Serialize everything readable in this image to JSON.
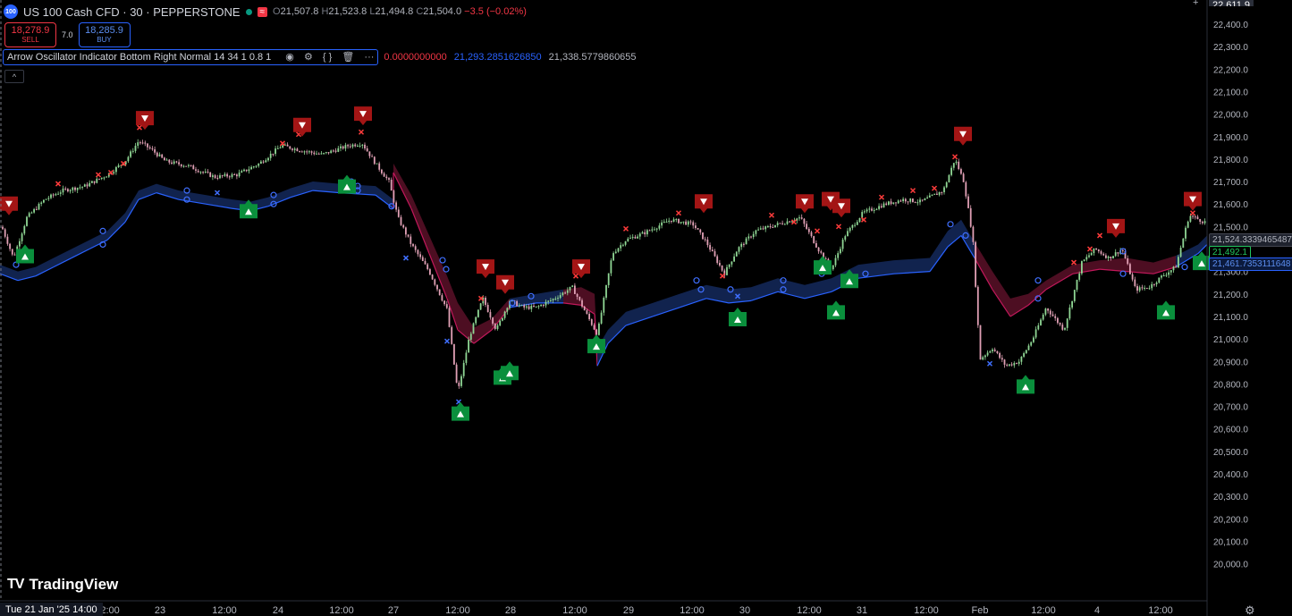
{
  "header": {
    "symbol_badge": "100",
    "symbol_title": "US 100 Cash CFD · 30 · PEPPERSTONE",
    "ohlc": {
      "o_label": "O",
      "o": "21,507.8",
      "h_label": "H",
      "h": "21,523.8",
      "l_label": "L",
      "l": "21,494.8",
      "c_label": "C",
      "c": "21,504.0",
      "change": "−3.5 (−0.02%)"
    }
  },
  "trade": {
    "sell_price": "18,278.9",
    "sell_label": "SELL",
    "spread": "7.0",
    "buy_price": "18,285.9",
    "buy_label": "BUY"
  },
  "indicator": {
    "name": "Arrow Oscillator Indicator Bottom Right Normal 14 34 1 0.8 1",
    "val1": "0.0000000000",
    "val2": "21,293.2851626850",
    "val3": "21,338.5779860655",
    "colors": {
      "val1": "#f23645",
      "val2": "#2962ff",
      "val3": "#b2b5be"
    }
  },
  "branding": {
    "logo_text": "TradingView"
  },
  "price_axis_extra": {
    "top_cut_label": "22,611.9",
    "pill_gray": "21,524.3339465487",
    "pill_green": "21,492.1",
    "pill_blue": "21,461.7353111648"
  },
  "time_axis_cursor": "Tue 21 Jan '25   14:00",
  "colors": {
    "background": "#000000",
    "bull": "#8fd694",
    "bear": "#e0a0b5",
    "buy_signal": "#0a8f3c",
    "sell_signal": "#a31515",
    "band_blue": "#14295c",
    "band_red": "#5a1028",
    "line_blue": "#2962ff",
    "line_red": "#c2185b"
  },
  "chart_data": {
    "type": "candlestick",
    "y_ticks": [
      "22,400.0",
      "22,300.0",
      "22,200.0",
      "22,100.0",
      "22,000.0",
      "21,900.0",
      "21,800.0",
      "21,700.0",
      "21,600.0",
      "21,500.0",
      "21,400.0",
      "21,300.0",
      "21,200.0",
      "21,100.0",
      "21,000.0",
      "20,900.0",
      "20,800.0",
      "20,700.0",
      "20,600.0",
      "20,500.0",
      "20,400.0",
      "20,300.0",
      "20,200.0",
      "20,100.0",
      "20,000.0"
    ],
    "x_ticks": [
      "12:00",
      "23",
      "12:00",
      "24",
      "12:00",
      "27",
      "12:00",
      "28",
      "12:00",
      "29",
      "12:00",
      "30",
      "12:00",
      "31",
      "12:00",
      "Feb",
      "12:00",
      "4",
      "12:00"
    ],
    "ylim": [
      19980,
      22510
    ],
    "price_path": [
      [
        0,
        21520
      ],
      [
        15,
        21360
      ],
      [
        30,
        21540
      ],
      [
        50,
        21620
      ],
      [
        70,
        21660
      ],
      [
        95,
        21680
      ],
      [
        120,
        21730
      ],
      [
        140,
        21790
      ],
      [
        155,
        21880
      ],
      [
        170,
        21840
      ],
      [
        185,
        21790
      ],
      [
        210,
        21770
      ],
      [
        240,
        21720
      ],
      [
        265,
        21730
      ],
      [
        290,
        21780
      ],
      [
        315,
        21860
      ],
      [
        335,
        21840
      ],
      [
        360,
        21820
      ],
      [
        390,
        21860
      ],
      [
        405,
        21870
      ],
      [
        420,
        21780
      ],
      [
        435,
        21700
      ],
      [
        445,
        21540
      ],
      [
        460,
        21420
      ],
      [
        480,
        21300
      ],
      [
        500,
        21130
      ],
      [
        512,
        20760
      ],
      [
        525,
        21010
      ],
      [
        540,
        21180
      ],
      [
        555,
        21040
      ],
      [
        570,
        21170
      ],
      [
        585,
        21140
      ],
      [
        600,
        21140
      ],
      [
        620,
        21180
      ],
      [
        640,
        21230
      ],
      [
        660,
        21080
      ],
      [
        668,
        21020
      ],
      [
        685,
        21380
      ],
      [
        700,
        21440
      ],
      [
        720,
        21470
      ],
      [
        750,
        21530
      ],
      [
        775,
        21510
      ],
      [
        790,
        21430
      ],
      [
        810,
        21290
      ],
      [
        825,
        21400
      ],
      [
        845,
        21480
      ],
      [
        870,
        21510
      ],
      [
        895,
        21540
      ],
      [
        915,
        21400
      ],
      [
        930,
        21310
      ],
      [
        945,
        21460
      ],
      [
        965,
        21560
      ],
      [
        990,
        21600
      ],
      [
        1010,
        21620
      ],
      [
        1030,
        21610
      ],
      [
        1055,
        21660
      ],
      [
        1068,
        21800
      ],
      [
        1078,
        21700
      ],
      [
        1088,
        21450
      ],
      [
        1096,
        20910
      ],
      [
        1110,
        20960
      ],
      [
        1125,
        20880
      ],
      [
        1140,
        20900
      ],
      [
        1155,
        21000
      ],
      [
        1170,
        21140
      ],
      [
        1190,
        21040
      ],
      [
        1210,
        21340
      ],
      [
        1225,
        21400
      ],
      [
        1240,
        21360
      ],
      [
        1255,
        21400
      ],
      [
        1270,
        21220
      ],
      [
        1285,
        21230
      ],
      [
        1300,
        21280
      ],
      [
        1315,
        21320
      ],
      [
        1330,
        21550
      ],
      [
        1347,
        21520
      ]
    ],
    "band": [
      [
        0,
        21330,
        21290,
        "b"
      ],
      [
        20,
        21300,
        21260,
        "b"
      ],
      [
        40,
        21320,
        21280,
        "b"
      ],
      [
        60,
        21360,
        21320,
        "b"
      ],
      [
        80,
        21400,
        21360,
        "b"
      ],
      [
        100,
        21440,
        21400,
        "b"
      ],
      [
        120,
        21480,
        21440,
        "b"
      ],
      [
        140,
        21560,
        21520,
        "b"
      ],
      [
        155,
        21660,
        21620,
        "b"
      ],
      [
        175,
        21690,
        21650,
        "b"
      ],
      [
        200,
        21660,
        21620,
        "b"
      ],
      [
        230,
        21640,
        21600,
        "b"
      ],
      [
        260,
        21620,
        21580,
        "b"
      ],
      [
        280,
        21610,
        21570,
        "b"
      ],
      [
        300,
        21630,
        21590,
        "b"
      ],
      [
        325,
        21670,
        21630,
        "b"
      ],
      [
        350,
        21700,
        21660,
        "b"
      ],
      [
        380,
        21690,
        21650,
        "b"
      ],
      [
        420,
        21680,
        21640,
        "b"
      ],
      [
        440,
        21620,
        21580,
        "r"
      ],
      [
        440,
        21780,
        21740,
        "r"
      ],
      [
        460,
        21640,
        21580,
        "r"
      ],
      [
        480,
        21460,
        21380,
        "r"
      ],
      [
        500,
        21280,
        21180,
        "r"
      ],
      [
        512,
        21160,
        21040,
        "r"
      ],
      [
        530,
        21050,
        20980,
        "r"
      ],
      [
        550,
        21090,
        21040,
        "r"
      ],
      [
        570,
        21180,
        21140,
        "b"
      ],
      [
        600,
        21200,
        21160,
        "b"
      ],
      [
        630,
        21220,
        21160,
        "r"
      ],
      [
        650,
        21230,
        21150,
        "r"
      ],
      [
        665,
        21200,
        21110,
        "r"
      ],
      [
        668,
        20960,
        20880,
        "b"
      ],
      [
        680,
        21040,
        20980,
        "b"
      ],
      [
        700,
        21120,
        21060,
        "b"
      ],
      [
        730,
        21160,
        21100,
        "b"
      ],
      [
        760,
        21200,
        21140,
        "b"
      ],
      [
        790,
        21240,
        21180,
        "b"
      ],
      [
        815,
        21220,
        21160,
        "b"
      ],
      [
        840,
        21230,
        21170,
        "b"
      ],
      [
        870,
        21270,
        21210,
        "b"
      ],
      [
        900,
        21240,
        21180,
        "b"
      ],
      [
        930,
        21270,
        21210,
        "b"
      ],
      [
        960,
        21330,
        21270,
        "b"
      ],
      [
        1000,
        21350,
        21290,
        "b"
      ],
      [
        1040,
        21360,
        21300,
        "b"
      ],
      [
        1060,
        21480,
        21410,
        "b"
      ],
      [
        1075,
        21530,
        21460,
        "b"
      ],
      [
        1090,
        21430,
        21360,
        "r"
      ],
      [
        1110,
        21300,
        21220,
        "r"
      ],
      [
        1130,
        21180,
        21100,
        "r"
      ],
      [
        1150,
        21200,
        21150,
        "r"
      ],
      [
        1170,
        21260,
        21220,
        "r"
      ],
      [
        1200,
        21330,
        21290,
        "r"
      ],
      [
        1230,
        21350,
        21310,
        "r"
      ],
      [
        1260,
        21360,
        21300,
        "r"
      ],
      [
        1290,
        21340,
        21290,
        "r"
      ],
      [
        1315,
        21370,
        21320,
        "b"
      ],
      [
        1340,
        21420,
        21380,
        "b"
      ],
      [
        1350,
        21460,
        21420,
        "b"
      ]
    ],
    "sell_signals": [
      [
        10,
        21590
      ],
      [
        162,
        21970
      ],
      [
        338,
        21940
      ],
      [
        406,
        21990
      ],
      [
        543,
        21310
      ],
      [
        565,
        21240
      ],
      [
        650,
        21310
      ],
      [
        787,
        21600
      ],
      [
        900,
        21600
      ],
      [
        929,
        21610
      ],
      [
        941,
        21580
      ],
      [
        1077,
        21900
      ],
      [
        1248,
        21490
      ],
      [
        1334,
        21610
      ]
    ],
    "buy_signals": [
      [
        28,
        21380
      ],
      [
        278,
        21580
      ],
      [
        388,
        21690
      ],
      [
        515,
        20680
      ],
      [
        562,
        20840
      ],
      [
        570,
        20860
      ],
      [
        667,
        20980
      ],
      [
        825,
        21100
      ],
      [
        920,
        21330
      ],
      [
        935,
        21130
      ],
      [
        950,
        21270
      ],
      [
        1147,
        20800
      ],
      [
        1304,
        21130
      ],
      [
        1344,
        21350
      ]
    ],
    "cross_marks": [
      [
        65,
        21690,
        "r"
      ],
      [
        110,
        21730,
        "r"
      ],
      [
        124,
        21740,
        "r"
      ],
      [
        138,
        21780,
        "r"
      ],
      [
        156,
        21940,
        "r"
      ],
      [
        243,
        21650,
        "b"
      ],
      [
        316,
        21870,
        "r"
      ],
      [
        334,
        21910,
        "r"
      ],
      [
        404,
        21920,
        "r"
      ],
      [
        454,
        21360,
        "b"
      ],
      [
        500,
        20990,
        "b"
      ],
      [
        513,
        20720,
        "b"
      ],
      [
        538,
        21180,
        "r"
      ],
      [
        644,
        21280,
        "r"
      ],
      [
        700,
        21490,
        "r"
      ],
      [
        759,
        21560,
        "r"
      ],
      [
        808,
        21280,
        "r"
      ],
      [
        825,
        21190,
        "b"
      ],
      [
        863,
        21550,
        "r"
      ],
      [
        888,
        21520,
        "r"
      ],
      [
        914,
        21480,
        "r"
      ],
      [
        938,
        21500,
        "r"
      ],
      [
        966,
        21530,
        "r"
      ],
      [
        986,
        21630,
        "r"
      ],
      [
        1021,
        21660,
        "r"
      ],
      [
        1045,
        21670,
        "r"
      ],
      [
        1068,
        21810,
        "r"
      ],
      [
        1107,
        20890,
        "b"
      ],
      [
        1201,
        21340,
        "r"
      ],
      [
        1219,
        21400,
        "r"
      ],
      [
        1230,
        21460,
        "r"
      ],
      [
        1334,
        21560,
        "r"
      ]
    ],
    "circle_marks": [
      [
        18,
        21330
      ],
      [
        115,
        21480
      ],
      [
        115,
        21420
      ],
      [
        209,
        21660
      ],
      [
        209,
        21620
      ],
      [
        306,
        21600
      ],
      [
        306,
        21640
      ],
      [
        393,
        21700
      ],
      [
        400,
        21680
      ],
      [
        400,
        21660
      ],
      [
        438,
        21590
      ],
      [
        495,
        21350
      ],
      [
        499,
        21310
      ],
      [
        573,
        21160
      ],
      [
        594,
        21190
      ],
      [
        779,
        21260
      ],
      [
        784,
        21220
      ],
      [
        817,
        21220
      ],
      [
        876,
        21220
      ],
      [
        876,
        21260
      ],
      [
        919,
        21290
      ],
      [
        968,
        21290
      ],
      [
        1063,
        21510
      ],
      [
        1080,
        21460
      ],
      [
        1161,
        21260
      ],
      [
        1161,
        21180
      ],
      [
        1256,
        21390
      ],
      [
        1256,
        21290
      ],
      [
        1325,
        21320
      ]
    ]
  }
}
